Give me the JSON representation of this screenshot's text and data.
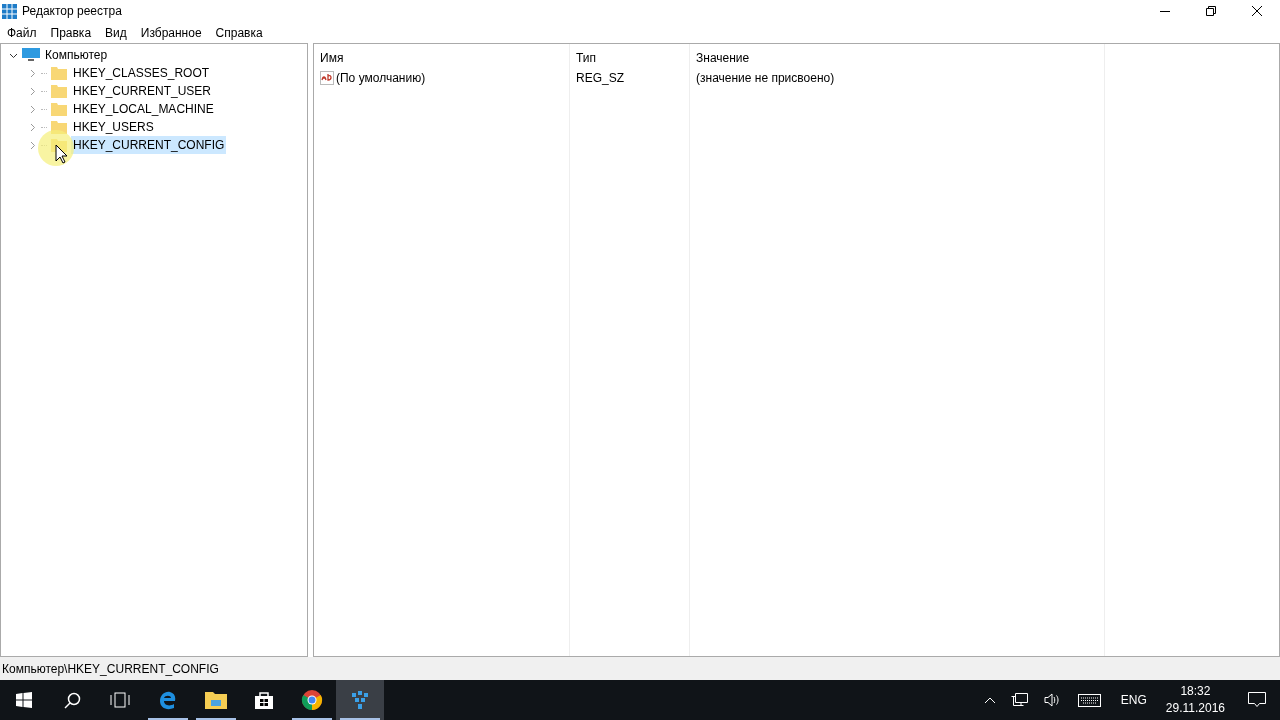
{
  "window": {
    "title": "Редактор реестра"
  },
  "menu": [
    "Файл",
    "Правка",
    "Вид",
    "Избранное",
    "Справка"
  ],
  "tree": {
    "label": "Компьютер",
    "expanded": true,
    "selected": false,
    "children": [
      {
        "label": "HKEY_CLASSES_ROOT",
        "expanded": false,
        "selected": false
      },
      {
        "label": "HKEY_CURRENT_USER",
        "expanded": false,
        "selected": false
      },
      {
        "label": "HKEY_LOCAL_MACHINE",
        "expanded": false,
        "selected": false
      },
      {
        "label": "HKEY_USERS",
        "expanded": false,
        "selected": false
      },
      {
        "label": "HKEY_CURRENT_CONFIG",
        "expanded": false,
        "selected": true
      }
    ]
  },
  "table": {
    "columns": [
      "Имя",
      "Тип",
      "Значение"
    ],
    "rows": [
      {
        "name": "(По умолчанию)",
        "type": "REG_SZ",
        "value": "(значение не присвоено)"
      }
    ]
  },
  "status_bar": "Компьютер\\HKEY_CURRENT_CONFIG",
  "taskbar": {
    "apps": [
      {
        "kind": "start",
        "running": false,
        "selected": false
      },
      {
        "kind": "search",
        "running": false,
        "selected": false
      },
      {
        "kind": "taskview",
        "running": false,
        "selected": false
      },
      {
        "kind": "edge",
        "running": true,
        "selected": false
      },
      {
        "kind": "explorer",
        "running": true,
        "selected": false
      },
      {
        "kind": "store",
        "running": false,
        "selected": false
      },
      {
        "kind": "chrome",
        "running": true,
        "selected": false
      },
      {
        "kind": "regedit",
        "running": true,
        "selected": true
      }
    ],
    "language": "ENG",
    "time": "18:32",
    "date": "29.11.2016"
  }
}
